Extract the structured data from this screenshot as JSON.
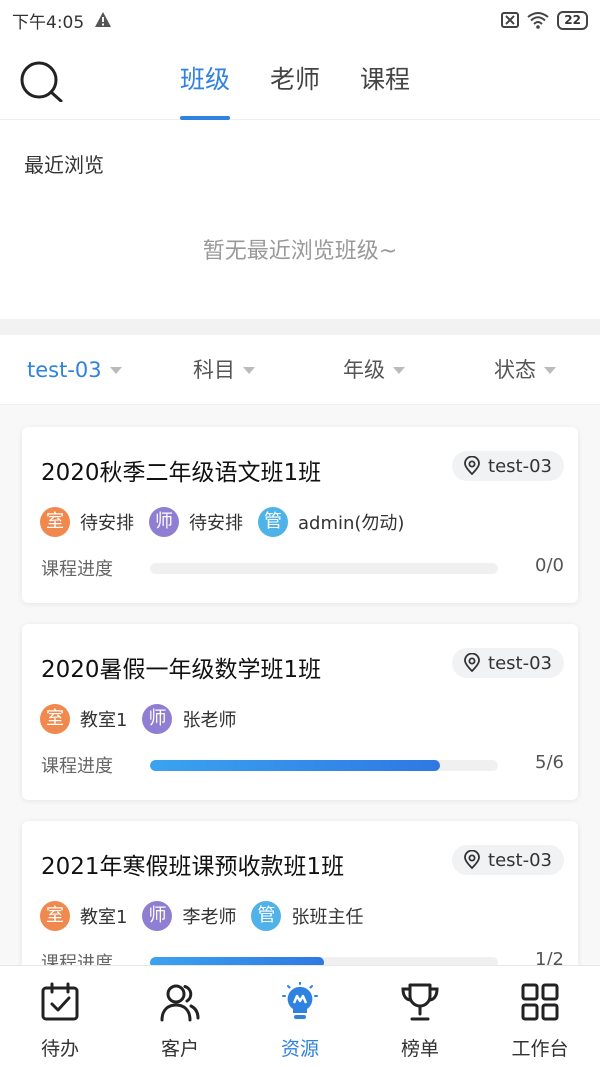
{
  "status_bar": {
    "time": "下午4:05",
    "battery": "22"
  },
  "tabs": [
    {
      "label": "班级",
      "active": true
    },
    {
      "label": "老师",
      "active": false
    },
    {
      "label": "课程",
      "active": false
    }
  ],
  "recent": {
    "title": "最近浏览",
    "empty_text": "暂无最近浏览班级~"
  },
  "filters": [
    {
      "label": "test-03",
      "active": true
    },
    {
      "label": "科目",
      "active": false
    },
    {
      "label": "年级",
      "active": false
    },
    {
      "label": "状态",
      "active": false
    }
  ],
  "classes": [
    {
      "title": "2020秋季二年级语文班1班",
      "location": "test-03",
      "tags": [
        {
          "icon": "室",
          "text": "待安排",
          "color": "#f0894e"
        },
        {
          "icon": "师",
          "text": "待安排",
          "color": "#8f7fd3"
        },
        {
          "icon": "管",
          "text": "admin(勿动)",
          "color": "#4fb3ea"
        }
      ],
      "progress_label": "课程进度",
      "progress_value": "0/0",
      "progress_fraction": 0
    },
    {
      "title": "2020暑假一年级数学班1班",
      "location": "test-03",
      "tags": [
        {
          "icon": "室",
          "text": "教室1",
          "color": "#f0894e"
        },
        {
          "icon": "师",
          "text": "张老师",
          "color": "#8f7fd3"
        }
      ],
      "progress_label": "课程进度",
      "progress_value": "5/6",
      "progress_fraction": 0.8333
    },
    {
      "title": "2021年寒假班课预收款班1班",
      "location": "test-03",
      "tags": [
        {
          "icon": "室",
          "text": "教室1",
          "color": "#f0894e"
        },
        {
          "icon": "师",
          "text": "李老师",
          "color": "#8f7fd3"
        },
        {
          "icon": "管",
          "text": "张班主任",
          "color": "#4fb3ea"
        }
      ],
      "progress_label": "课程进度",
      "progress_value": "1/2",
      "progress_fraction": 0.5
    }
  ],
  "bottom_nav": [
    {
      "label": "待办",
      "icon": "calendar-check-icon",
      "active": false
    },
    {
      "label": "客户",
      "icon": "users-icon",
      "active": false
    },
    {
      "label": "资源",
      "icon": "bulb-icon",
      "active": true
    },
    {
      "label": "榜单",
      "icon": "trophy-icon",
      "active": false
    },
    {
      "label": "工作台",
      "icon": "grid-icon",
      "active": false
    }
  ],
  "colors": {
    "accent": "#2f82e0"
  }
}
